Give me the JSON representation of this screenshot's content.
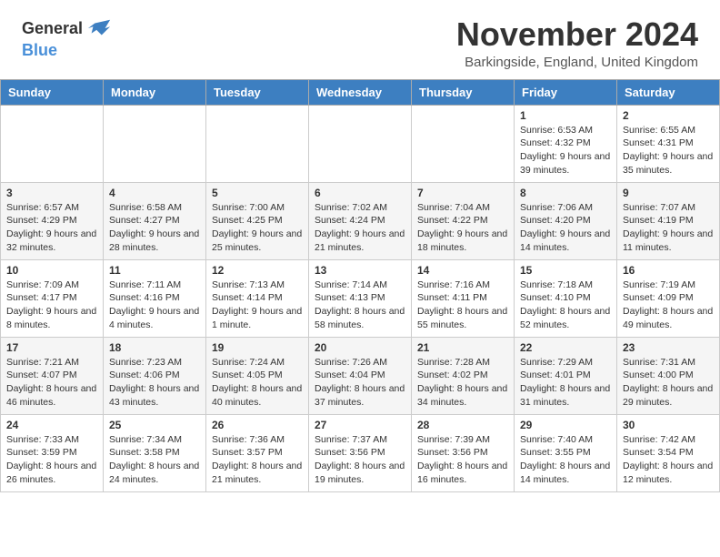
{
  "header": {
    "logo_general": "General",
    "logo_blue": "Blue",
    "month_title": "November 2024",
    "location": "Barkingside, England, United Kingdom"
  },
  "calendar": {
    "days_of_week": [
      "Sunday",
      "Monday",
      "Tuesday",
      "Wednesday",
      "Thursday",
      "Friday",
      "Saturday"
    ],
    "weeks": [
      [
        {
          "day": "",
          "info": ""
        },
        {
          "day": "",
          "info": ""
        },
        {
          "day": "",
          "info": ""
        },
        {
          "day": "",
          "info": ""
        },
        {
          "day": "",
          "info": ""
        },
        {
          "day": "1",
          "info": "Sunrise: 6:53 AM\nSunset: 4:32 PM\nDaylight: 9 hours and 39 minutes."
        },
        {
          "day": "2",
          "info": "Sunrise: 6:55 AM\nSunset: 4:31 PM\nDaylight: 9 hours and 35 minutes."
        }
      ],
      [
        {
          "day": "3",
          "info": "Sunrise: 6:57 AM\nSunset: 4:29 PM\nDaylight: 9 hours and 32 minutes."
        },
        {
          "day": "4",
          "info": "Sunrise: 6:58 AM\nSunset: 4:27 PM\nDaylight: 9 hours and 28 minutes."
        },
        {
          "day": "5",
          "info": "Sunrise: 7:00 AM\nSunset: 4:25 PM\nDaylight: 9 hours and 25 minutes."
        },
        {
          "day": "6",
          "info": "Sunrise: 7:02 AM\nSunset: 4:24 PM\nDaylight: 9 hours and 21 minutes."
        },
        {
          "day": "7",
          "info": "Sunrise: 7:04 AM\nSunset: 4:22 PM\nDaylight: 9 hours and 18 minutes."
        },
        {
          "day": "8",
          "info": "Sunrise: 7:06 AM\nSunset: 4:20 PM\nDaylight: 9 hours and 14 minutes."
        },
        {
          "day": "9",
          "info": "Sunrise: 7:07 AM\nSunset: 4:19 PM\nDaylight: 9 hours and 11 minutes."
        }
      ],
      [
        {
          "day": "10",
          "info": "Sunrise: 7:09 AM\nSunset: 4:17 PM\nDaylight: 9 hours and 8 minutes."
        },
        {
          "day": "11",
          "info": "Sunrise: 7:11 AM\nSunset: 4:16 PM\nDaylight: 9 hours and 4 minutes."
        },
        {
          "day": "12",
          "info": "Sunrise: 7:13 AM\nSunset: 4:14 PM\nDaylight: 9 hours and 1 minute."
        },
        {
          "day": "13",
          "info": "Sunrise: 7:14 AM\nSunset: 4:13 PM\nDaylight: 8 hours and 58 minutes."
        },
        {
          "day": "14",
          "info": "Sunrise: 7:16 AM\nSunset: 4:11 PM\nDaylight: 8 hours and 55 minutes."
        },
        {
          "day": "15",
          "info": "Sunrise: 7:18 AM\nSunset: 4:10 PM\nDaylight: 8 hours and 52 minutes."
        },
        {
          "day": "16",
          "info": "Sunrise: 7:19 AM\nSunset: 4:09 PM\nDaylight: 8 hours and 49 minutes."
        }
      ],
      [
        {
          "day": "17",
          "info": "Sunrise: 7:21 AM\nSunset: 4:07 PM\nDaylight: 8 hours and 46 minutes."
        },
        {
          "day": "18",
          "info": "Sunrise: 7:23 AM\nSunset: 4:06 PM\nDaylight: 8 hours and 43 minutes."
        },
        {
          "day": "19",
          "info": "Sunrise: 7:24 AM\nSunset: 4:05 PM\nDaylight: 8 hours and 40 minutes."
        },
        {
          "day": "20",
          "info": "Sunrise: 7:26 AM\nSunset: 4:04 PM\nDaylight: 8 hours and 37 minutes."
        },
        {
          "day": "21",
          "info": "Sunrise: 7:28 AM\nSunset: 4:02 PM\nDaylight: 8 hours and 34 minutes."
        },
        {
          "day": "22",
          "info": "Sunrise: 7:29 AM\nSunset: 4:01 PM\nDaylight: 8 hours and 31 minutes."
        },
        {
          "day": "23",
          "info": "Sunrise: 7:31 AM\nSunset: 4:00 PM\nDaylight: 8 hours and 29 minutes."
        }
      ],
      [
        {
          "day": "24",
          "info": "Sunrise: 7:33 AM\nSunset: 3:59 PM\nDaylight: 8 hours and 26 minutes."
        },
        {
          "day": "25",
          "info": "Sunrise: 7:34 AM\nSunset: 3:58 PM\nDaylight: 8 hours and 24 minutes."
        },
        {
          "day": "26",
          "info": "Sunrise: 7:36 AM\nSunset: 3:57 PM\nDaylight: 8 hours and 21 minutes."
        },
        {
          "day": "27",
          "info": "Sunrise: 7:37 AM\nSunset: 3:56 PM\nDaylight: 8 hours and 19 minutes."
        },
        {
          "day": "28",
          "info": "Sunrise: 7:39 AM\nSunset: 3:56 PM\nDaylight: 8 hours and 16 minutes."
        },
        {
          "day": "29",
          "info": "Sunrise: 7:40 AM\nSunset: 3:55 PM\nDaylight: 8 hours and 14 minutes."
        },
        {
          "day": "30",
          "info": "Sunrise: 7:42 AM\nSunset: 3:54 PM\nDaylight: 8 hours and 12 minutes."
        }
      ]
    ]
  }
}
